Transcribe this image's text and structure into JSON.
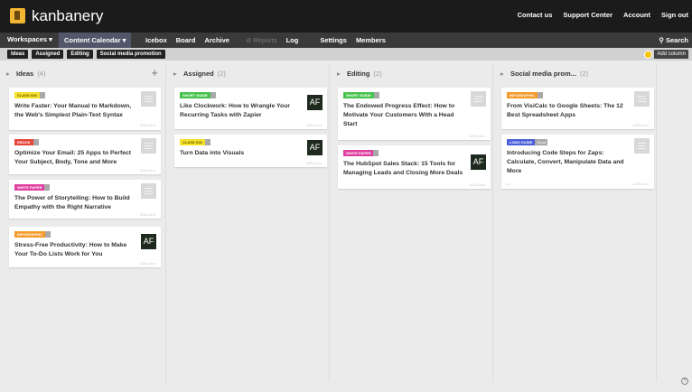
{
  "header": {
    "app_title": "kanbanery",
    "links": [
      "Contact us",
      "Support Center",
      "Account",
      "Sign out"
    ]
  },
  "nav": {
    "workspaces": "Workspaces",
    "calendar": "Content Calendar",
    "items": [
      "Icebox",
      "Board",
      "Archive",
      "Reports",
      "Log",
      "Settings",
      "Members"
    ],
    "search": "Search"
  },
  "filters": {
    "chips": [
      "Ideas",
      "Assigned",
      "Editing",
      "Social media promotion"
    ],
    "add_column": "Add column"
  },
  "colors": {
    "accent_yellow": "#f5e02a",
    "tag_green": "#45c24b",
    "tag_red": "#e8443a",
    "tag_pink": "#de3fa0",
    "tag_orange": "#f59a2a",
    "tag_blue": "#4a5fd8"
  },
  "columns": [
    {
      "name": "Ideas",
      "count": "(4)",
      "plus": "+",
      "cards": [
        {
          "tag": "CLASS ION",
          "tag_color": "#f5e02a",
          "title": "Write Faster: Your Manual to Markdown, the Web's Simplest Plain-Text Syntax",
          "meta": "1225 d.d.m"
        },
        {
          "tag": "EBOOK",
          "tag_color": "#e8443a",
          "title": "Optimize Your Email: 25 Apps to Perfect Your Subject, Body, Tone and More",
          "meta": "1225 d.d.m"
        },
        {
          "tag": "WHITE PAPER",
          "tag_color": "#de3fa0",
          "title": "The Power of Storytelling: How to Build Empathy with the Right Narrative",
          "meta": "1225 d.d.m"
        },
        {
          "tag": "INFOGRAPHIC",
          "tag_color": "#f59a2a",
          "title": "Stress-Free Productivity: How to Make Your To-Do Lists Work for You",
          "meta": "1225 d.d.m",
          "avatar": "AF"
        }
      ]
    },
    {
      "name": "Assigned",
      "count": "(2)",
      "cards": [
        {
          "tag": "SHORT GUIDE",
          "tag_color": "#45c24b",
          "title": "Like Clockwork: How to Wrangle Your Recurring Tasks with Zapier",
          "meta": "1225 d.d.m",
          "avatar": "AF"
        },
        {
          "tag": "CLASS ION",
          "tag_color": "#f5e02a",
          "title": "Turn Data into Visuals",
          "meta": "1225 d.d.m",
          "avatar": "AF"
        }
      ]
    },
    {
      "name": "Editing",
      "count": "(2)",
      "cards": [
        {
          "tag": "SHORT GUIDE",
          "tag_color": "#45c24b",
          "title": "The Endowed Progress Effect: How to Motivate Your Customers With a Head Start",
          "meta": "1225 d.d.m"
        },
        {
          "tag": "WHITE PAPER",
          "tag_color": "#de3fa0",
          "title": "The HubSpot Sales Stack: 15 Tools for Managing Leads and Closing More Deals",
          "meta": "1225 d.d.m",
          "avatar": "AF"
        }
      ]
    },
    {
      "name": "Social media prom...",
      "count": "(2)",
      "cards": [
        {
          "tag": "INFOGRAPHIC",
          "tag_color": "#f59a2a",
          "title": "From VisiCalc to Google Sheets: The 12 Best Spreadsheet Apps",
          "meta": "1225 d.d.m"
        },
        {
          "tag": "LONG GUIDE",
          "tag_color": "#4a5fd8",
          "tag2": "Email",
          "title": "Introducing Code Steps for Zaps: Calculate, Convert, Manipulate Data and More",
          "meta": "1225 d.d.m",
          "meta_left": "▸ ✓"
        }
      ]
    }
  ],
  "help": "?"
}
